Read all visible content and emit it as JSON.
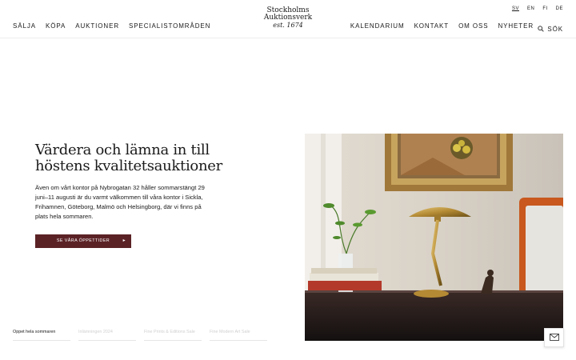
{
  "header": {
    "nav_left": [
      "SÄLJA",
      "KÖPA",
      "AUKTIONER",
      "SPECIALISTOMRÅDEN"
    ],
    "nav_right": [
      "KALENDARIUM",
      "KONTAKT",
      "OM OSS",
      "NYHETER"
    ],
    "languages": [
      "SV",
      "EN",
      "FI",
      "DE"
    ],
    "active_language": "SV",
    "search_label": "SÖK",
    "logo": {
      "line1": "Stockholms",
      "line2": "Auktionsverk",
      "line3": "est. 1674"
    }
  },
  "hero": {
    "headline_line1": "Värdera och lämna in till",
    "headline_line2": "höstens kvalitetsauktioner",
    "lead": "Även om vårt kontor på Nybrogatan 32 håller sommarstängt 29 juni–11 augusti är du varmt välkommen till våra kontor i Sickla, Frihamnen, Göteborg, Malmö och Helsingborg, där vi finns på plats hela sommaren.",
    "cta_label": "SE VÅRA ÖPPETTIDER",
    "cta_color": "#5b2226"
  },
  "slider_tabs": [
    "Öppet hela sommaren",
    "Inlämningen 2024",
    "Fine Prints & Editions Sale",
    "Fine Modern Art Sale"
  ],
  "active_tab": 0,
  "icons": {
    "search": "search-icon",
    "cta_arrow": "play-arrow-icon",
    "mail": "mail-icon"
  }
}
